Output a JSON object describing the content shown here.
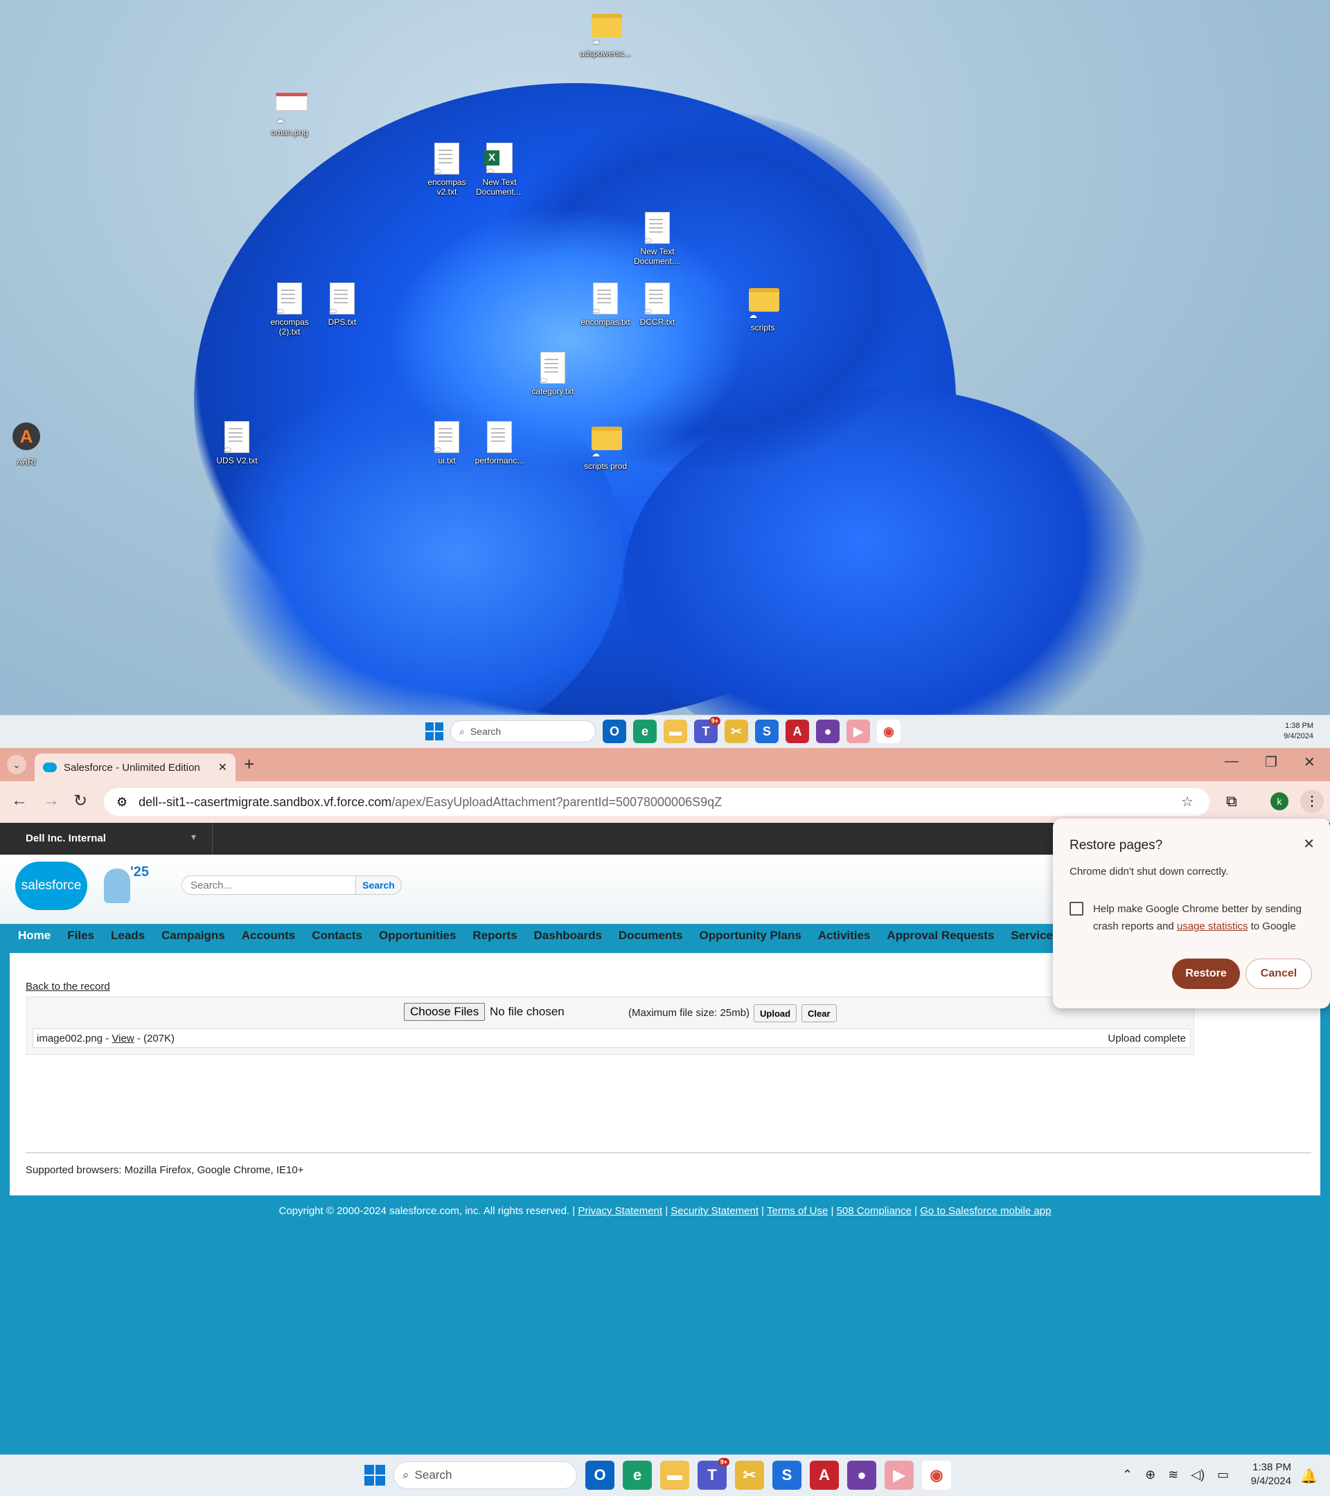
{
  "desktop_icons": [
    {
      "label": "udspowersc...",
      "type": "folder"
    },
    {
      "label": "oman.png",
      "type": "image"
    },
    {
      "label": "encompas v2.txt",
      "type": "doc"
    },
    {
      "label": "New Text Document....",
      "type": "xls"
    },
    {
      "label": "New Text Document....",
      "type": "doc"
    },
    {
      "label": "encompas (2).txt",
      "type": "doc"
    },
    {
      "label": "DPS.txt",
      "type": "doc"
    },
    {
      "label": "encompas.txt",
      "type": "doc"
    },
    {
      "label": "DCCR.txt",
      "type": "doc"
    },
    {
      "label": "scripts",
      "type": "folder"
    },
    {
      "label": "category.txt",
      "type": "doc"
    },
    {
      "label": "AARI",
      "type": "app"
    },
    {
      "label": "UDS V2.txt",
      "type": "doc"
    },
    {
      "label": "ui.txt",
      "type": "doc"
    },
    {
      "label": "performanc...",
      "type": "doc"
    },
    {
      "label": "scripts prod",
      "type": "folder"
    }
  ],
  "taskbar": {
    "search_placeholder": "Search",
    "time": "1:38 PM",
    "date": "9/4/2024",
    "teams_badge": "9+"
  },
  "browser": {
    "tab_title": "Salesforce - Unlimited Edition",
    "url_host": "dell--sit1--casertmigrate.sandbox.vf.force.com",
    "url_path": "/apex/EasyUploadAttachment?parentId=50078000006S9qZ",
    "profile_initial": "k"
  },
  "salesforce": {
    "org_name": "Dell Inc. Internal",
    "logo_text": "salesforce",
    "release": "'25",
    "search_placeholder": "Search...",
    "search_button": "Search",
    "tabs": [
      "Home",
      "Files",
      "Leads",
      "Campaigns",
      "Accounts",
      "Contacts",
      "Opportunities",
      "Reports",
      "Dashboards",
      "Documents",
      "Opportunity Plans",
      "Activities",
      "Approval Requests",
      "Services Pro"
    ],
    "back_link": "Back to the record",
    "choose_files": "Choose Files",
    "no_file": "No file chosen",
    "max_size": "(Maximum file size: 25mb)",
    "upload_button": "Upload",
    "clear_button": "Clear",
    "file_name": "image002.png - ",
    "file_view": "View",
    "file_size": " - (207K)",
    "file_status": "Upload complete",
    "supported_browsers": "Supported browsers: Mozilla Firefox, Google Chrome, IE10+",
    "copyright": "Copyright © 2000-2024 salesforce.com, inc. All rights reserved. | ",
    "footer_links": [
      "Privacy Statement",
      "Security Statement",
      "Terms of Use",
      "508 Compliance",
      "Go to Salesforce mobile app"
    ]
  },
  "restore_dialog": {
    "title": "Restore pages?",
    "message": "Chrome didn't shut down correctly.",
    "checkbox_text_1": "Help make Google Chrome better by sending crash reports and ",
    "checkbox_link": "usage statistics",
    "checkbox_text_2": " to Google",
    "restore_button": "Restore",
    "cancel_button": "Cancel"
  }
}
